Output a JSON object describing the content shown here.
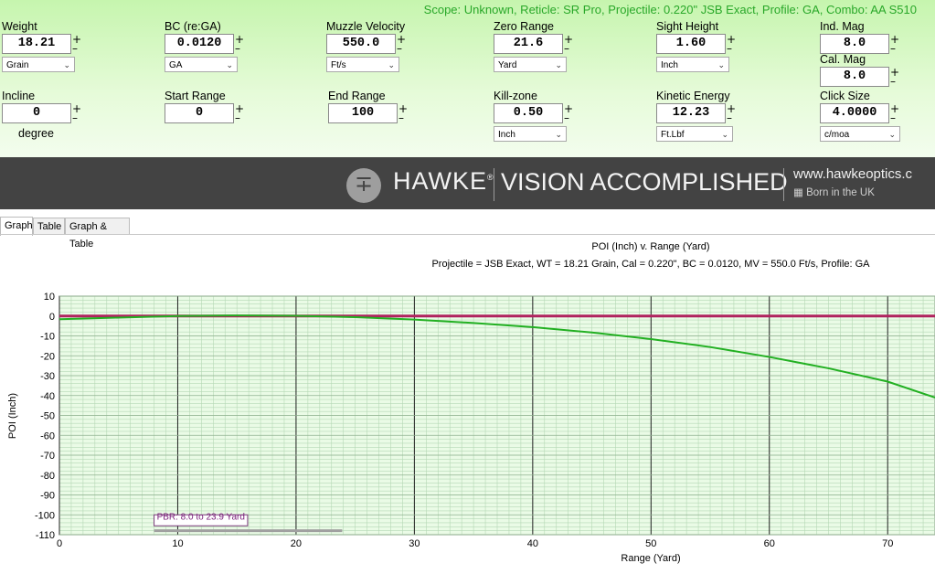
{
  "info_line": "Scope: Unknown, Reticle: SR Pro, Projectile: 0.220\" JSB Exact, Profile: GA, Combo: AA S510",
  "fields": {
    "weight": {
      "label": "Weight",
      "value": "18.21",
      "unit": "Grain"
    },
    "bc": {
      "label": "BC (re:GA)",
      "value": "0.0120",
      "unit": "GA"
    },
    "muzzle_velocity": {
      "label": "Muzzle Velocity",
      "value": "550.0",
      "unit": "Ft/s"
    },
    "zero_range": {
      "label": "Zero Range",
      "value": "21.6",
      "unit": "Yard"
    },
    "sight_height": {
      "label": "Sight Height",
      "value": "1.60",
      "unit": "Inch"
    },
    "ind_mag": {
      "label": "Ind. Mag",
      "value": "8.0"
    },
    "cal_mag": {
      "label": "Cal. Mag",
      "value": "8.0"
    },
    "incline": {
      "label": "Incline",
      "value": "0",
      "unit": "degree"
    },
    "start_range": {
      "label": "Start Range",
      "value": "0"
    },
    "end_range": {
      "label": "End Range",
      "value": "100"
    },
    "kill_zone": {
      "label": "Kill-zone",
      "value": "0.50",
      "unit": "Inch"
    },
    "kinetic_energy": {
      "label": "Kinetic Energy",
      "value": "12.23",
      "unit": "Ft.Lbf"
    },
    "click_size": {
      "label": "Click Size",
      "value": "4.0000",
      "unit": "c/moa"
    }
  },
  "spinner": {
    "plus": "+",
    "minus": "–"
  },
  "banner": {
    "brand": "HAWKE",
    "registered": "®",
    "slogan": "VISION ACCOMPLISHED",
    "website": "www.hawkeoptics.c",
    "born": "Born in the UK"
  },
  "tabs": [
    {
      "label": "Graph",
      "active": true
    },
    {
      "label": "Table",
      "active": false
    },
    {
      "label": "Graph & Table",
      "active": false
    }
  ],
  "colors": {
    "info_text": "#29a829",
    "trajectory": "#22b022",
    "zero_line": "#b0225e",
    "pbr_bar": "#a0a0a0",
    "plot_bg": "#eafbe6"
  },
  "chart_data": {
    "type": "line",
    "title": "POI (Inch) v. Range (Yard)",
    "subtitle": "Projectile = JSB Exact, WT = 18.21 Grain, Cal = 0.220\", BC = 0.0120, MV = 550.0 Ft/s, Profile: GA",
    "xlabel": "Range (Yard)",
    "ylabel": "POI (Inch)",
    "xlim": [
      0,
      74
    ],
    "ylim": [
      -110,
      10
    ],
    "xticks": [
      0,
      10,
      20,
      30,
      40,
      50,
      60,
      70
    ],
    "yticks": [
      10,
      0,
      -10,
      -20,
      -30,
      -40,
      -50,
      -60,
      -70,
      -80,
      -90,
      -100,
      -110
    ],
    "grid": true,
    "series": [
      {
        "kind": "trajectory",
        "x": [
          0,
          5,
          10,
          15,
          20,
          25,
          30,
          35,
          40,
          45,
          50,
          55,
          60,
          65,
          70,
          74
        ],
        "y": [
          -1.6,
          -0.8,
          0.0,
          0.3,
          0.1,
          -0.6,
          -1.8,
          -3.5,
          -5.6,
          -8.3,
          -11.6,
          -15.6,
          -20.6,
          -26.3,
          -33.0,
          -41.0
        ]
      },
      {
        "kind": "zero",
        "x": [
          0,
          74
        ],
        "y": [
          0,
          0
        ]
      }
    ],
    "annotation": {
      "text": "PBR: 8.0 to 23.9 Yard",
      "start": 8.0,
      "end": 23.9
    }
  }
}
